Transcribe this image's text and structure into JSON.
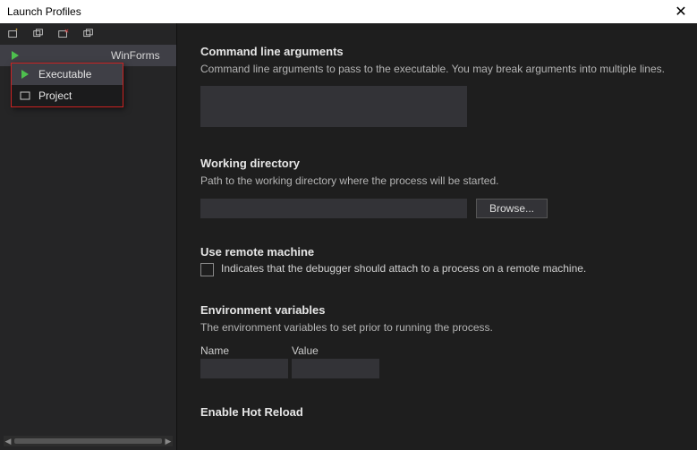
{
  "window": {
    "title": "Launch Profiles"
  },
  "sidebar": {
    "profile_suffix": "WinForms",
    "dropdown": {
      "items": [
        {
          "label": "Executable",
          "icon": "executable-icon"
        },
        {
          "label": "Project",
          "icon": "project-icon"
        }
      ]
    }
  },
  "main": {
    "cmdline": {
      "title": "Command line arguments",
      "desc": "Command line arguments to pass to the executable. You may break arguments into multiple lines.",
      "value": ""
    },
    "workdir": {
      "title": "Working directory",
      "desc": "Path to the working directory where the process will be started.",
      "value": "",
      "browse_label": "Browse..."
    },
    "remote": {
      "title": "Use remote machine",
      "checkbox_label": "Indicates that the debugger should attach to a process on a remote machine."
    },
    "envvars": {
      "title": "Environment variables",
      "desc": "The environment variables to set prior to running the process.",
      "name_header": "Name",
      "value_header": "Value"
    },
    "hotreload": {
      "title": "Enable Hot Reload"
    }
  }
}
